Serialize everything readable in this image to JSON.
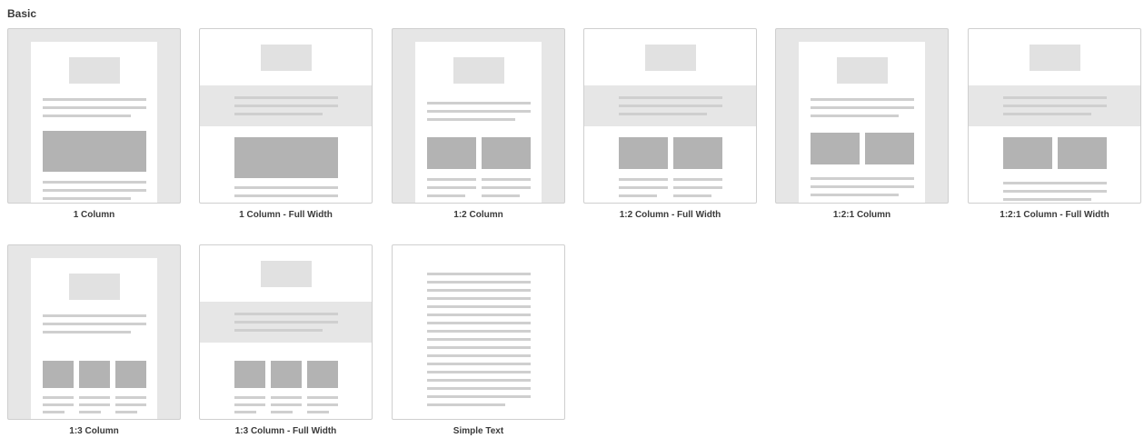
{
  "section": {
    "title": "Basic"
  },
  "templates": [
    {
      "name": "1 Column"
    },
    {
      "name": "1 Column - Full Width"
    },
    {
      "name": "1:2 Column"
    },
    {
      "name": "1:2 Column - Full Width"
    },
    {
      "name": "1:2:1 Column"
    },
    {
      "name": "1:2:1 Column - Full Width"
    },
    {
      "name": "1:3 Column"
    },
    {
      "name": "1:3 Column - Full Width"
    },
    {
      "name": "Simple Text"
    }
  ]
}
